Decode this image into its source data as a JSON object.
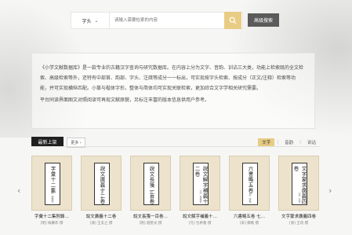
{
  "search": {
    "scope": "字头",
    "placeholder": "请输入需要检索的内容",
    "advanced_label": "高级搜索"
  },
  "intro": {
    "p1": "《小学文献数据库》是一款专业的古籍汉字查询与研究数据库。在内容上分为文字、音韵、训诂三大类，功能上检索既的全文检索、高级检索等外，还特有中部首、韵部、字头、注疏等成分一一标出，可实现按字头检索、按成分（正文/注释）检索等功能，并可实现横纵匹配。小篆与楷体字形，整体与简体均可实现关联检索，更加综合文字学相关研究需要。",
    "p2": "平台同读界面图文对照阅读可再现文献原貌，另标注丰富的版本信息供用户参考。"
  },
  "new_books": {
    "title": "最新上架",
    "more": "更多",
    "filters": [
      "文字",
      "音韵",
      "训诂"
    ],
    "active_filter": "文字",
    "items": [
      {
        "cover": "字彙十二集",
        "cover_sub": "（明）梅膺祚",
        "title": "字彙十二集附錄…",
        "author": "[明] 梅膺祚 撰"
      },
      {
        "cover": "說文廣義十二卷",
        "cover_sub": "（清）王夫之",
        "title": "說文廣義十二卷",
        "author": "[清] 王夫之 撰"
      },
      {
        "cover": "說文長箋一百卷",
        "cover_sub": "（明）趙宧光",
        "title": "說文長箋一百卷…",
        "author": "[明] 趙宧光 撰"
      },
      {
        "cover": "說文解字補義十二卷",
        "cover_sub": "（元）包希魯",
        "title": "說文解字補義十…",
        "author": "[元] 包希魯 撰"
      },
      {
        "cover": "六書略五卷",
        "cover_sub": "（宋）鄭樵",
        "title": "六書略五卷 七…",
        "author": "[宋] 鄭樵 撰"
      },
      {
        "cover": "文字蒙求廣義四卷",
        "cover_sub": "（清）王筠",
        "title": "文字蒙求廣義四卷",
        "author": "[清] 王筠 撰"
      }
    ]
  },
  "colors": {
    "accent": "#e8cc84",
    "dark": "#1f1f1f"
  }
}
